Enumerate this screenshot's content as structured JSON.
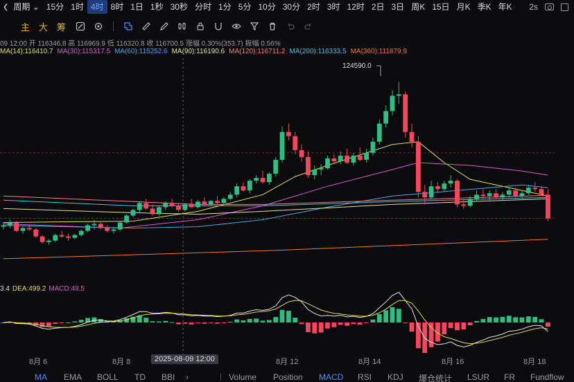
{
  "timeframes": {
    "period_label": "周期",
    "items": [
      "15分",
      "1时",
      "4时",
      "8时",
      "1日",
      "1秒",
      "30秒",
      "分时",
      "1分",
      "5分",
      "10分",
      "30分",
      "2时",
      "3时",
      "12时",
      "2日",
      "3日",
      "周K",
      "15日",
      "月K",
      "季K",
      "年K"
    ],
    "active": "4时",
    "refresh": "2s"
  },
  "toolbar": {
    "chars": [
      "主",
      "大",
      "筹"
    ]
  },
  "ohlc": {
    "date": "09 12:00",
    "open_label": "开",
    "open": "116346.8",
    "high_label": "高",
    "high": "116969.9",
    "low_label": "低",
    "low": "116320.8",
    "close_label": "收",
    "close": "116700.5",
    "change_label": "涨幅",
    "change": "0.30%(353.7)",
    "amp_label": "振幅",
    "amp": "0.56%"
  },
  "ma": [
    {
      "text": "MA(14):116410.7",
      "color": "#e8e04a"
    },
    {
      "text": "MA(30):115317.5",
      "color": "#d85cd0"
    },
    {
      "text": "MA(60):115252.6",
      "color": "#4aa8e8"
    },
    {
      "text": "MA(90):116190.6",
      "color": "#e6e6a0"
    },
    {
      "text": "MA(120):116711.2",
      "color": "#f08080"
    },
    {
      "text": "MA(200):116333.5",
      "color": "#4ac0e0"
    },
    {
      "text": "MA(360):111879.9",
      "color": "#f07a30"
    }
  ],
  "peak_label": "124590.0",
  "macd": {
    "dif": "3.4",
    "dea": "DEA:499.2",
    "macd": "MACD:48.5"
  },
  "xaxis": {
    "labels": [
      "8月 6",
      "8月 8",
      "8月 12",
      "8月 14",
      "8月 16",
      "8月 18"
    ],
    "crosshair": "2025-08-09 12:00"
  },
  "indicators": [
    "MA",
    "EMA",
    "BOLL",
    "TD",
    "BBI",
    "Volume",
    "Position",
    "MACD",
    "RSI",
    "KDJ",
    "爆仓统计",
    "LSUR",
    "FR",
    "Fundflow"
  ],
  "active_indicator": "MACD",
  "colors": {
    "up": "#2ebd85",
    "down": "#f6465d",
    "accent": "#4f8dff"
  },
  "chart_data": {
    "type": "candlestick",
    "scale": {
      "price_top": 126300,
      "price_bottom": 110900
    },
    "candles": [
      [
        114200,
        114500,
        114000,
        114300
      ],
      [
        114300,
        114700,
        114100,
        114500
      ],
      [
        114500,
        114600,
        113800,
        113900
      ],
      [
        113900,
        114200,
        113700,
        114100
      ],
      [
        114100,
        114300,
        113900,
        114000
      ],
      [
        114000,
        114100,
        113400,
        113500
      ],
      [
        113500,
        113600,
        113000,
        113100
      ],
      [
        113100,
        113300,
        112900,
        113200
      ],
      [
        113200,
        113700,
        113100,
        113600
      ],
      [
        113600,
        113900,
        113400,
        113500
      ],
      [
        113500,
        113700,
        113200,
        113400
      ],
      [
        113400,
        113700,
        113300,
        113600
      ],
      [
        113600,
        114000,
        113500,
        113900
      ],
      [
        113900,
        114400,
        113800,
        114300
      ],
      [
        114300,
        114700,
        114000,
        114400
      ],
      [
        114400,
        114600,
        114000,
        114100
      ],
      [
        114100,
        114300,
        113800,
        113900
      ],
      [
        113900,
        114200,
        113700,
        114000
      ],
      [
        114000,
        114600,
        113900,
        114500
      ],
      [
        114500,
        115100,
        114400,
        115000
      ],
      [
        115000,
        115500,
        114900,
        115400
      ],
      [
        115400,
        116000,
        115200,
        115900
      ],
      [
        115900,
        116200,
        115400,
        115500
      ],
      [
        115500,
        115800,
        115000,
        115100
      ],
      [
        115100,
        115700,
        115000,
        115600
      ],
      [
        115600,
        116000,
        115400,
        115900
      ],
      [
        115900,
        116200,
        115600,
        115700
      ],
      [
        115700,
        115900,
        115300,
        115400
      ],
      [
        115400,
        115900,
        115300,
        115800
      ],
      [
        115800,
        116200,
        115500,
        115600
      ],
      [
        115600,
        116100,
        115500,
        116000
      ],
      [
        116000,
        116300,
        115700,
        115800
      ],
      [
        115800,
        116100,
        115700,
        116050
      ],
      [
        116050,
        116400,
        115800,
        115900
      ],
      [
        115900,
        116300,
        115800,
        116200
      ],
      [
        116200,
        116700,
        116100,
        116500
      ],
      [
        116500,
        117300,
        116300,
        117100
      ],
      [
        117100,
        117400,
        116700,
        116800
      ],
      [
        116800,
        117600,
        116600,
        117500
      ],
      [
        117500,
        117900,
        117300,
        117700
      ],
      [
        117700,
        118200,
        117300,
        117400
      ],
      [
        117400,
        118100,
        117200,
        118000
      ],
      [
        118000,
        119200,
        117800,
        119000
      ],
      [
        119000,
        121400,
        118800,
        121000
      ],
      [
        121000,
        121600,
        120400,
        120700
      ],
      [
        120700,
        121000,
        119400,
        119700
      ],
      [
        119700,
        120100,
        118900,
        119200
      ],
      [
        119200,
        119600,
        117700,
        117900
      ],
      [
        117900,
        118600,
        117600,
        118300
      ],
      [
        118300,
        118700,
        117900,
        118400
      ],
      [
        118400,
        119300,
        118300,
        119100
      ],
      [
        119100,
        119400,
        118700,
        118900
      ],
      [
        118900,
        119600,
        118700,
        119300
      ],
      [
        119300,
        119800,
        118700,
        118800
      ],
      [
        118800,
        119500,
        118600,
        119300
      ],
      [
        119300,
        119900,
        118900,
        119000
      ],
      [
        119000,
        119800,
        118800,
        119500
      ],
      [
        119500,
        120600,
        119300,
        120300
      ],
      [
        120300,
        121900,
        120100,
        121600
      ],
      [
        121600,
        122900,
        121300,
        122500
      ],
      [
        122500,
        124000,
        122200,
        123600
      ],
      [
        123600,
        124590,
        123000,
        123700
      ],
      [
        123700,
        123900,
        120600,
        121000
      ],
      [
        121000,
        121600,
        119900,
        120300
      ],
      [
        120300,
        120700,
        116300,
        116700
      ],
      [
        116700,
        117200,
        115800,
        116300
      ],
      [
        116300,
        117500,
        116200,
        117100
      ],
      [
        117100,
        117400,
        116600,
        116900
      ],
      [
        116900,
        117500,
        116700,
        117300
      ],
      [
        117300,
        117900,
        117000,
        117500
      ],
      [
        117500,
        117600,
        115600,
        115800
      ],
      [
        115800,
        116200,
        115500,
        115700
      ],
      [
        115700,
        116400,
        115600,
        116200
      ],
      [
        116200,
        116800,
        116000,
        116500
      ],
      [
        116500,
        116900,
        116200,
        116400
      ],
      [
        116400,
        116800,
        116100,
        116600
      ],
      [
        116600,
        116900,
        116200,
        116300
      ],
      [
        116300,
        116700,
        116100,
        116500
      ],
      [
        116500,
        117000,
        116300,
        116800
      ],
      [
        116800,
        117000,
        116300,
        116400
      ],
      [
        116400,
        116800,
        116200,
        116600
      ],
      [
        116600,
        117200,
        116500,
        117000
      ],
      [
        117000,
        117400,
        116700,
        116900
      ],
      [
        116900,
        117100,
        116400,
        116500
      ],
      [
        116500,
        116900,
        114600,
        114800
      ]
    ],
    "ma_lines": [
      {
        "name": "MA(14)",
        "color": "#e8e04a",
        "points": [
          [
            0,
            114500
          ],
          [
            20,
            114600
          ],
          [
            30,
            115300
          ],
          [
            40,
            116500
          ],
          [
            45,
            117800
          ],
          [
            50,
            118600
          ],
          [
            60,
            120100
          ],
          [
            64,
            120300
          ],
          [
            68,
            118800
          ],
          [
            72,
            117600
          ],
          [
            80,
            116800
          ],
          [
            84,
            116400
          ]
        ]
      },
      {
        "name": "MA(30)",
        "color": "#d85cd0",
        "points": [
          [
            0,
            114400
          ],
          [
            18,
            114100
          ],
          [
            30,
            114700
          ],
          [
            40,
            115700
          ],
          [
            50,
            117100
          ],
          [
            60,
            118300
          ],
          [
            64,
            118800
          ],
          [
            72,
            118600
          ],
          [
            80,
            118200
          ],
          [
            84,
            117900
          ]
        ]
      },
      {
        "name": "MA(60)",
        "color": "#4aa8e8",
        "points": [
          [
            0,
            114300
          ],
          [
            20,
            114100
          ],
          [
            30,
            114200
          ],
          [
            40,
            114700
          ],
          [
            50,
            115600
          ],
          [
            60,
            116400
          ],
          [
            70,
            116800
          ],
          [
            80,
            117200
          ],
          [
            84,
            117000
          ]
        ]
      },
      {
        "name": "MA(90)",
        "color": "#e6e6a0",
        "points": [
          [
            0,
            115500
          ],
          [
            20,
            115200
          ],
          [
            30,
            115100
          ],
          [
            40,
            115300
          ],
          [
            60,
            115800
          ],
          [
            84,
            116200
          ]
        ]
      },
      {
        "name": "MA(120)",
        "color": "#f08080",
        "points": [
          [
            0,
            116400
          ],
          [
            20,
            116000
          ],
          [
            30,
            115800
          ],
          [
            40,
            115800
          ],
          [
            60,
            116100
          ],
          [
            84,
            116450
          ]
        ]
      },
      {
        "name": "MA(200)",
        "color": "#4ac0e0",
        "points": [
          [
            0,
            116100
          ],
          [
            20,
            115700
          ],
          [
            40,
            115700
          ],
          [
            60,
            116000
          ],
          [
            84,
            116300
          ]
        ]
      },
      {
        "name": "MA(360)",
        "color": "#f07a30",
        "points": [
          [
            0,
            111900
          ],
          [
            42,
            112500
          ],
          [
            84,
            113300
          ]
        ]
      }
    ],
    "price_ref": 114800,
    "ref_high": 119500
  }
}
